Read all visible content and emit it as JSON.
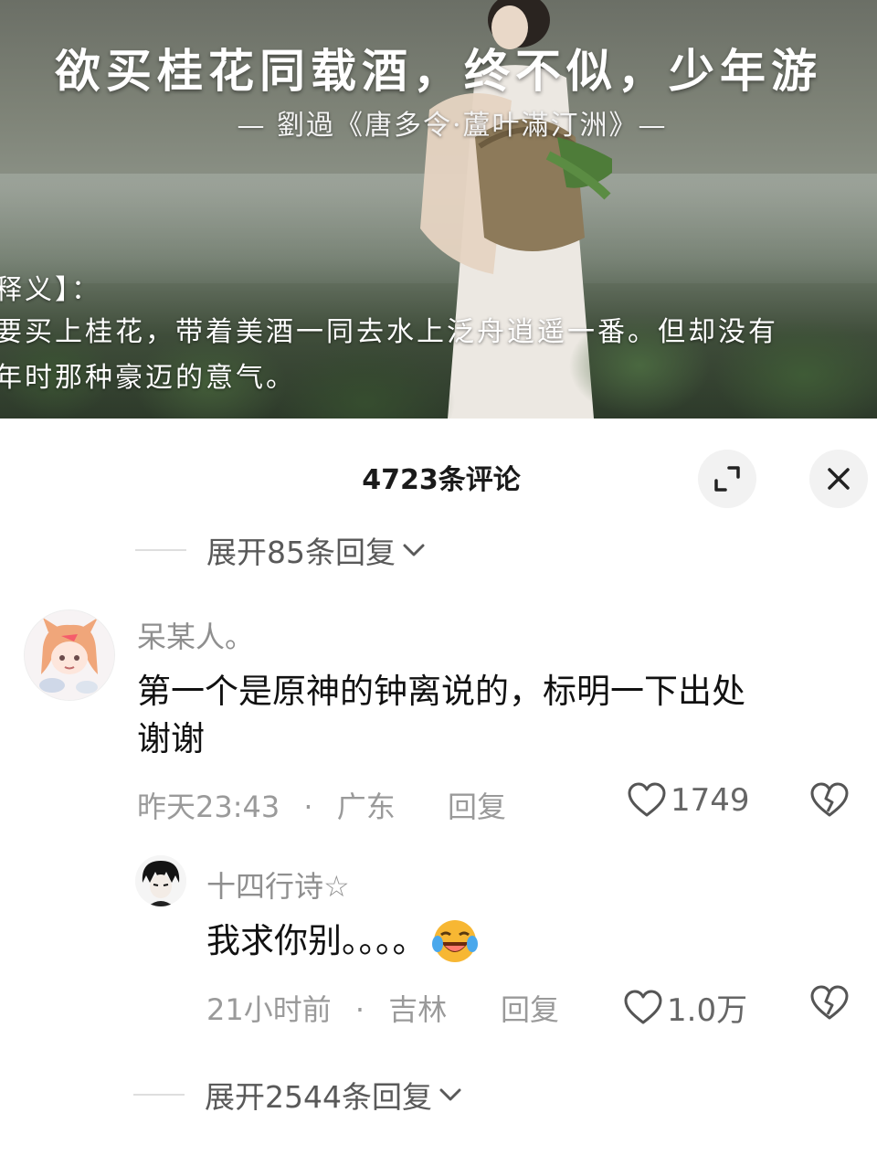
{
  "video": {
    "title": "欲买桂花同载酒，终不似，少年游",
    "subtitle": "— 劉過《唐多令·蘆叶滿汀洲》—",
    "explain_lines": [
      "释义】：",
      "要买上桂花，带着美酒一同去水上泛舟逍遥一番。但却没有",
      "年时那种豪迈的意气。"
    ]
  },
  "header": {
    "comment_count": "4723条评论"
  },
  "expand_replies_top": "展开85条回复",
  "comments": [
    {
      "username": "呆某人。",
      "content_line1": "第一个是原神的钟离说的，标明一下出处",
      "content_line2": "谢谢",
      "time": "昨天23:43",
      "separator": "·",
      "location": "广东",
      "reply_label": "回复",
      "likes": "1749"
    },
    {
      "username": "十四行诗☆",
      "content": "我求你别。。。。",
      "time": "21小时前",
      "separator": "·",
      "location": "吉林",
      "reply_label": "回复",
      "likes": "1.0万"
    }
  ],
  "expand_replies_bottom": "展开2544条回复",
  "icons": {
    "expand": "expand-icon",
    "close": "close-icon",
    "chevron": "chevron-down-icon",
    "like": "heart-icon",
    "dislike": "broken-heart-icon",
    "emoji": "laughing-tears-emoji-icon"
  },
  "colors": {
    "text_primary": "#111111",
    "text_secondary": "#9a9a9a",
    "button_bg": "#f2f2f2",
    "emoji_yellow": "#f7b733"
  }
}
